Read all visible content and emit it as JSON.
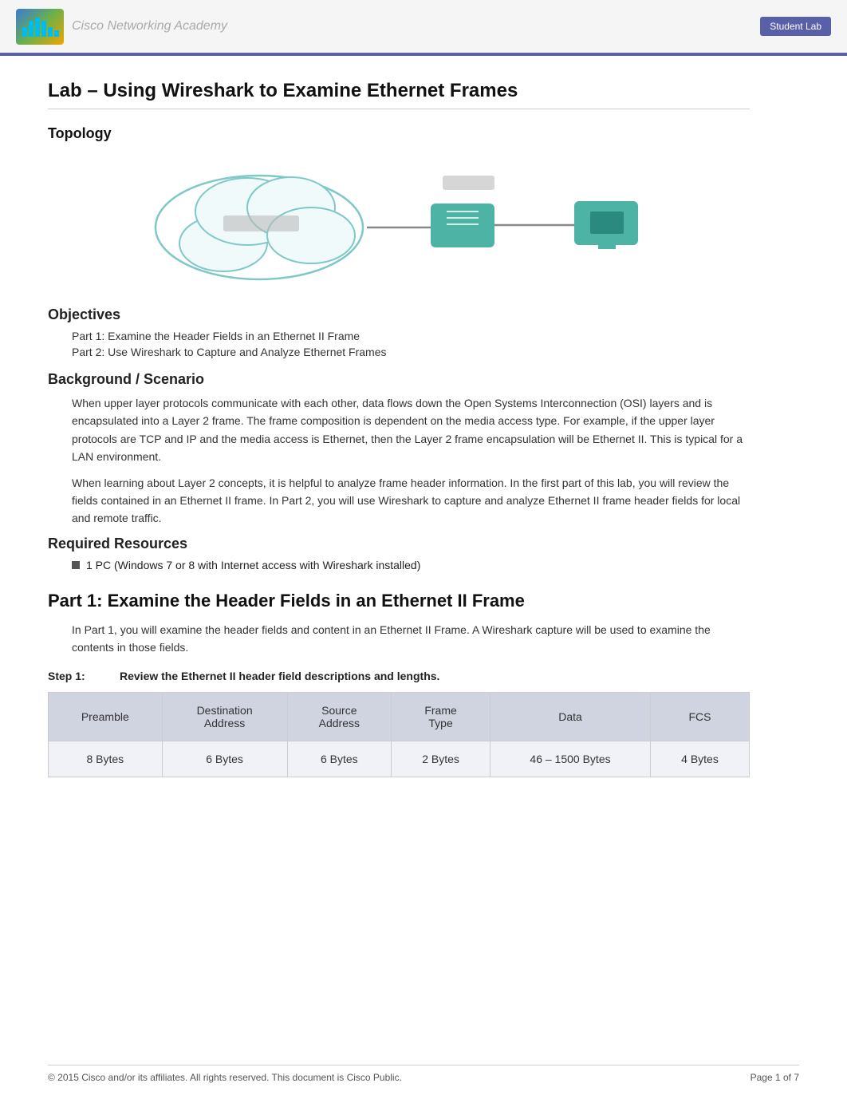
{
  "header": {
    "logo_alt": "Cisco",
    "academy_text": "Cisco Networking Academy",
    "right_label": "Student Lab"
  },
  "page": {
    "title": "Lab – Using Wireshark to Examine Ethernet Frames",
    "topology_label": "Topology",
    "objectives_heading": "Objectives",
    "objectives": [
      "Part 1: Examine the Header Fields in an Ethernet II Frame",
      "Part 2: Use Wireshark to Capture and Analyze Ethernet Frames"
    ],
    "background_heading": "Background / Scenario",
    "background_paragraphs": [
      "When upper layer protocols communicate with each other, data flows down the Open Systems Interconnection (OSI) layers and is encapsulated into a Layer 2 frame. The frame composition is dependent on the media access type. For example, if the upper layer protocols are TCP and IP and the media access is Ethernet, then the Layer 2 frame encapsulation will be Ethernet II. This is typical for a LAN environment.",
      "When learning about Layer 2 concepts, it is helpful to analyze frame header information. In the first part of this lab, you will review the fields contained in an Ethernet II frame. In Part 2, you will use Wireshark to capture and analyze Ethernet II frame header fields for local and remote traffic."
    ],
    "resources_heading": "Required Resources",
    "resources": [
      "1 PC (Windows 7 or 8 with Internet access with Wireshark installed)"
    ],
    "part1_heading": "Part 1:    Examine the Header Fields in an Ethernet II Frame",
    "part1_intro": "In Part 1, you will examine the header fields and content in an Ethernet II Frame. A Wireshark capture will be used to examine the contents in those fields.",
    "step1_label": "Step 1:",
    "step1_text": "Review the Ethernet II header field descriptions and lengths.",
    "table": {
      "headers": [
        "Preamble",
        "Destination\nAddress",
        "Source\nAddress",
        "Frame\nType",
        "Data",
        "FCS"
      ],
      "rows": [
        [
          "8 Bytes",
          "6 Bytes",
          "6 Bytes",
          "2 Bytes",
          "46 – 1500 Bytes",
          "4 Bytes"
        ]
      ]
    },
    "footer": {
      "copyright": "© 2015 Cisco and/or its affiliates. All rights reserved. This document is Cisco Public.",
      "page_info": "Page   1 of 7"
    }
  }
}
